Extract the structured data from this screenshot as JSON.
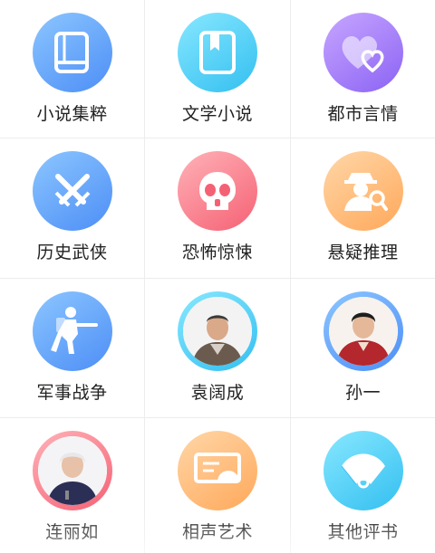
{
  "categories": [
    {
      "label": "小说集粹",
      "icon": "book-icon"
    },
    {
      "label": "文学小说",
      "icon": "bookmark-book-icon"
    },
    {
      "label": "都市言情",
      "icon": "hearts-icon"
    },
    {
      "label": "历史武侠",
      "icon": "crossed-swords-icon"
    },
    {
      "label": "恐怖惊悚",
      "icon": "skull-icon"
    },
    {
      "label": "悬疑推理",
      "icon": "detective-icon"
    },
    {
      "label": "军事战争",
      "icon": "soldier-icon"
    },
    {
      "label": "袁阔成",
      "icon": "portrait-avatar"
    },
    {
      "label": "孙一",
      "icon": "portrait-avatar"
    },
    {
      "label": "连丽如",
      "icon": "portrait-avatar"
    },
    {
      "label": "相声艺术",
      "icon": "fan-icon"
    },
    {
      "label": "其他评书",
      "icon": "folding-fan-icon"
    }
  ]
}
